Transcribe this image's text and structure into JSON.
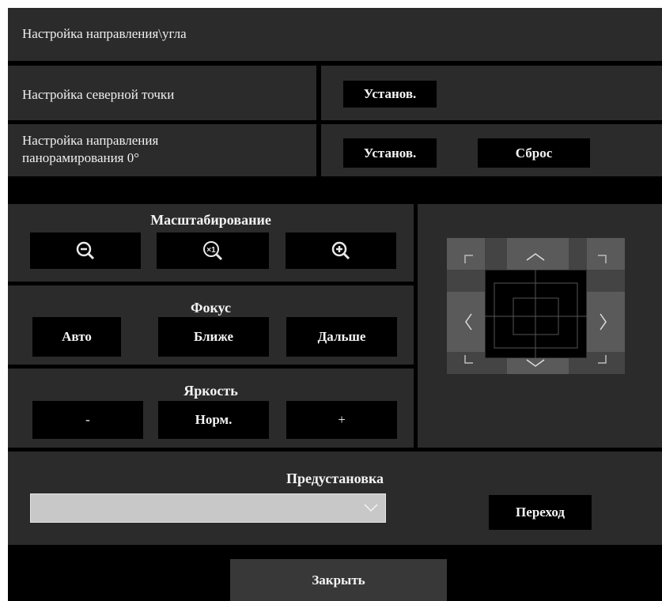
{
  "title": "Настройка направления\\угла",
  "north": {
    "label": "Настройка северной точки",
    "set_btn": "Установ."
  },
  "pan0": {
    "label": "Настройка направления панорамирования 0°",
    "set_btn": "Установ.",
    "reset_btn": "Сброс"
  },
  "zoom": {
    "title": "Масштабирование",
    "out_icon": "zoom-out-icon",
    "x1_icon": "zoom-x1-icon",
    "in_icon": "zoom-in-icon",
    "x1_text": "×1"
  },
  "focus": {
    "title": "Фокус",
    "auto": "Авто",
    "near": "Ближе",
    "far": "Дальше"
  },
  "brightness": {
    "title": "Яркость",
    "minus": "-",
    "normal": "Норм.",
    "plus": "+"
  },
  "preset": {
    "title": "Предустановка",
    "selected": "",
    "go_btn": "Переход"
  },
  "close_btn": "Закрыть"
}
